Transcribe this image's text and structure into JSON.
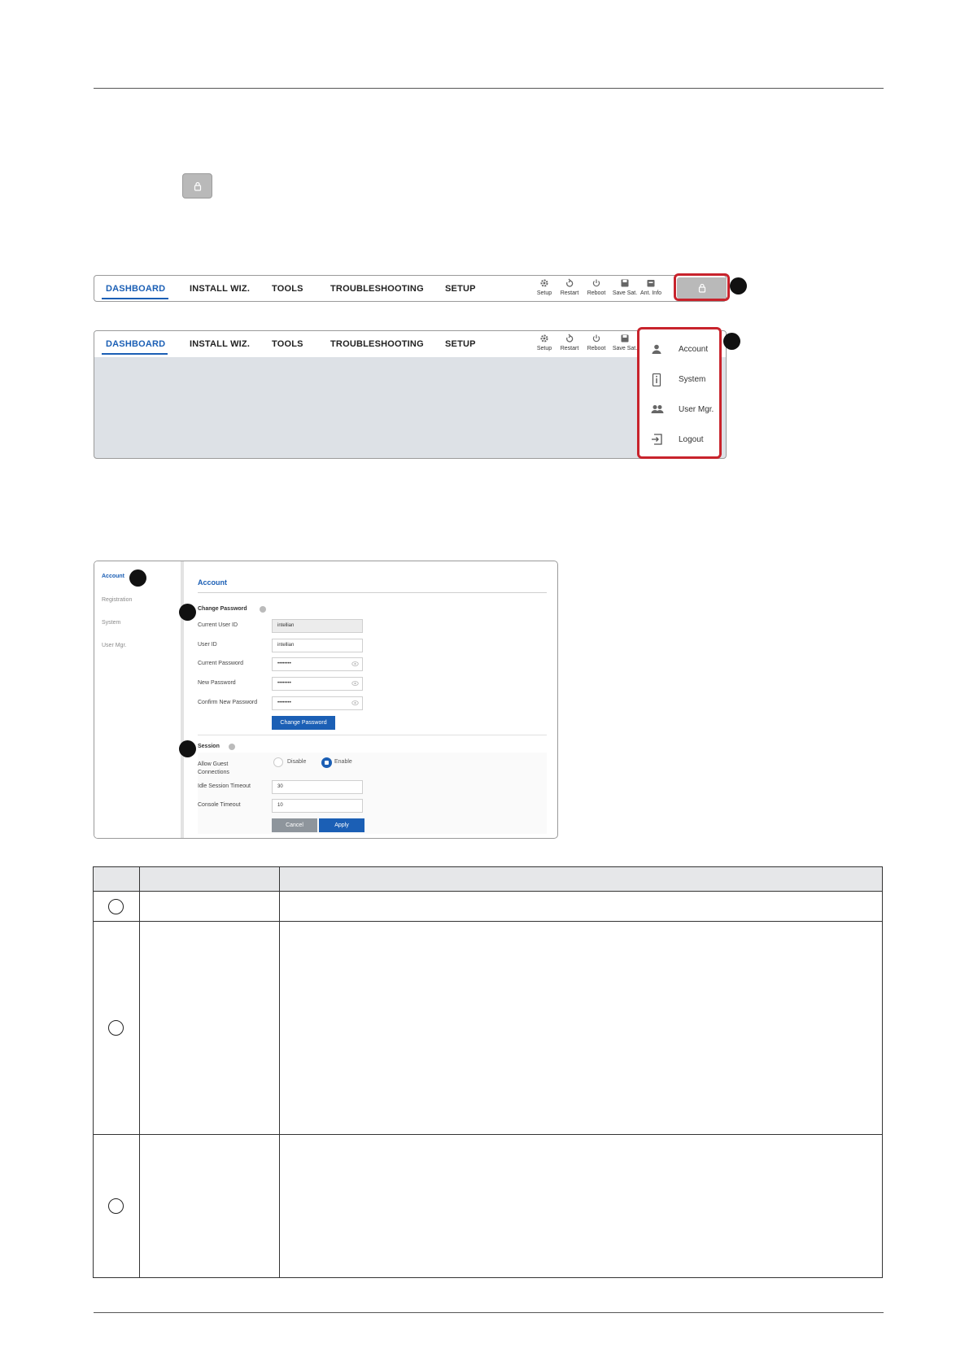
{
  "nav": {
    "tabs": [
      "DASHBOARD",
      "INSTALL WIZ.",
      "TOOLS",
      "TROUBLESHOOTING",
      "SETUP"
    ],
    "toolbar_bar1": [
      "Setup",
      "Restart",
      "Reboot",
      "Save Sat.",
      "Ant. Info"
    ],
    "toolbar_bar2": [
      "Setup",
      "Restart",
      "Reboot",
      "Save Sat."
    ]
  },
  "user_menu": {
    "items": [
      "Account",
      "System",
      "User Mgr.",
      "Logout"
    ]
  },
  "account_screen": {
    "sidebar": [
      "Account",
      "Registration",
      "System",
      "User Mgr."
    ],
    "title": "Account",
    "change_password": {
      "heading": "Change Password",
      "labels": [
        "Current User ID",
        "User ID",
        "Current Password",
        "New Password",
        "Confirm New Password"
      ],
      "values": [
        "intellian",
        "intellian",
        "••••••••",
        "••••••••",
        "••••••••"
      ],
      "button": "Change Password"
    },
    "session": {
      "heading": "Session",
      "guest_label": "Allow Guest Connections",
      "options": [
        "Disable",
        "Enable"
      ],
      "selected": "Enable",
      "idle_label": "Idle Session Timeout",
      "idle_value": "30",
      "console_label": "Console Timeout",
      "console_value": "10",
      "cancel": "Cancel",
      "apply": "Apply"
    }
  },
  "colors": {
    "accent": "#1b5fb5",
    "highlight": "#c8232c",
    "panel_gray": "#dde1e6"
  }
}
